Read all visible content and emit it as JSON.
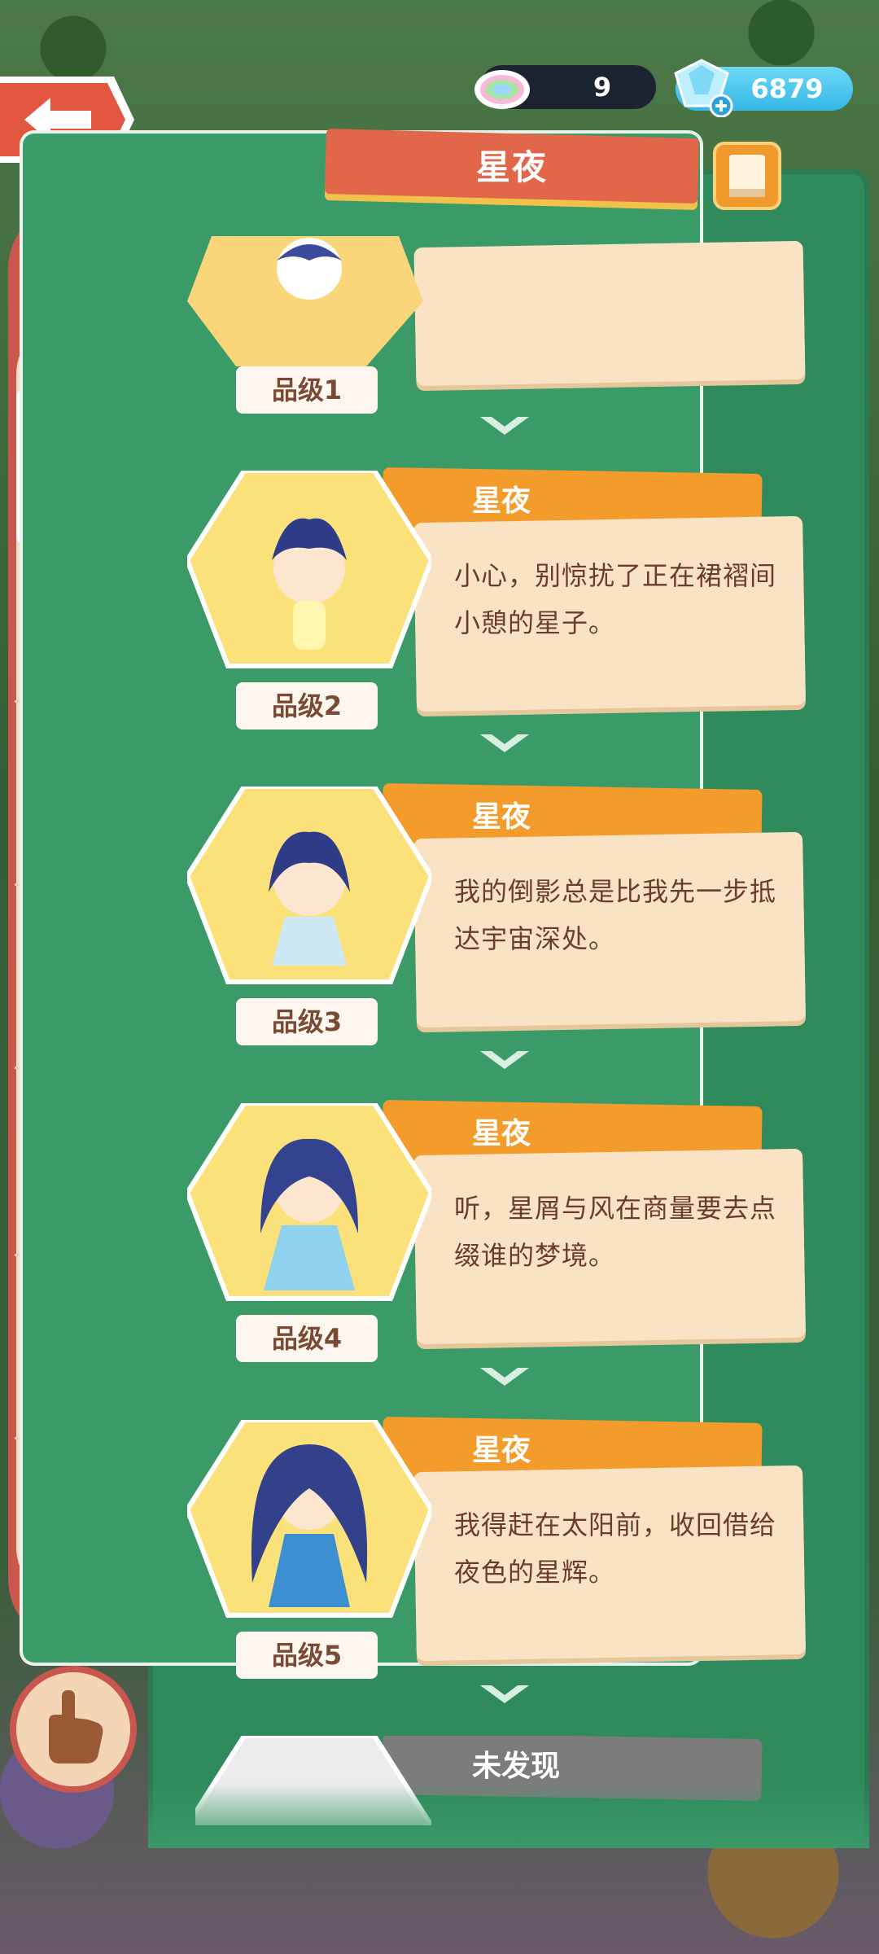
{
  "header": {
    "title": "星夜",
    "rainbow_count": "9",
    "gem_count": "6879"
  },
  "sidebar": {
    "items": [
      {
        "icon": "star-night-cat-icon",
        "selected": true
      },
      {
        "icon": "giraffe-hat-bun-icon"
      },
      {
        "icon": "orange-hair-bun-icon"
      },
      {
        "icon": "giraffe-icon"
      },
      {
        "icon": "deer-icon"
      },
      {
        "icon": "green-dino-icon"
      },
      {
        "icon": "bear-icon"
      }
    ]
  },
  "cards": [
    {
      "name": "星夜",
      "grade": "品级1",
      "desc": ""
    },
    {
      "name": "星夜",
      "grade": "品级2",
      "desc": "小心，别惊扰了正在裙褶间小憩的星子。"
    },
    {
      "name": "星夜",
      "grade": "品级3",
      "desc": "我的倒影总是比我先一步抵达宇宙深处。"
    },
    {
      "name": "星夜",
      "grade": "品级4",
      "desc": "听，星屑与风在商量要去点缀谁的梦境。"
    },
    {
      "name": "星夜",
      "grade": "品级5",
      "desc": "我得赶在太阳前，收回借给夜色的星辉。"
    },
    {
      "name": "未发现",
      "grade": "",
      "desc": ""
    }
  ],
  "colors": {
    "panel": "#2f8a5c",
    "namebar": "#f39b2b",
    "namebar_locked": "#7c7c7c",
    "desc_bg": "#fae3c4",
    "sidebar": "#c9574e",
    "selected": "#fbd02b"
  }
}
